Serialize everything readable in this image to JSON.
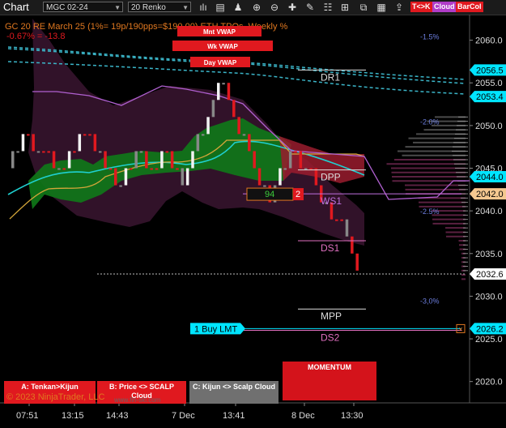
{
  "toolbar": {
    "title": "Chart",
    "instrument": "MGC 02-24",
    "bar_type": "20 Renko",
    "buttons": [
      {
        "label": "T<>K",
        "color": "#e0191f"
      },
      {
        "label": "Cloud",
        "color": "#b03cc8"
      },
      {
        "label": "BarCol",
        "color": "#e0191f"
      }
    ]
  },
  "header": {
    "line1": "GC 20 RE March 25 (1%= 19p/190pps=$190.00)  ETH TPOs, Weekly %",
    "line2": "-0.67% = -13.8",
    "copyright": "© 2023 NinjaTrader, LLC",
    "watermark": "www.fin-ski.com"
  },
  "vwap_labels": [
    "Mnt VWAP",
    "Wk VWAP",
    "Day VWAP"
  ],
  "levels": [
    {
      "name": "DR1",
      "price": 2056.5,
      "color": "#dddddd"
    },
    {
      "name": "DPP",
      "price": 2044.8,
      "color": "#dddddd"
    },
    {
      "name": "WS1",
      "price": 2042.0,
      "color": "#c070e0"
    },
    {
      "name": "DS1",
      "price": 2036.5,
      "color": "#e070c0"
    },
    {
      "name": "MPP",
      "price": 2028.5,
      "color": "#dddddd"
    },
    {
      "name": "DS2",
      "price": 2026.0,
      "color": "#e070c0"
    }
  ],
  "percent_labels": [
    {
      "label": "-1.5%",
      "price": 2060.5
    },
    {
      "label": "-2.0%",
      "price": 2050.5
    },
    {
      "label": "-2.5%",
      "price": 2040.0
    },
    {
      "label": "-3,0%",
      "price": 2029.5
    }
  ],
  "price_flags": [
    {
      "text": "2056.5",
      "price": 2056.5,
      "bg": "#00e5ff",
      "fg": "#000000"
    },
    {
      "text": "2053.4",
      "price": 2053.4,
      "bg": "#00e5ff",
      "fg": "#000000"
    },
    {
      "text": "2044.0",
      "price": 2044.0,
      "bg": "#00e5ff",
      "fg": "#000000"
    },
    {
      "text": "2042.0",
      "price": 2042.0,
      "bg": "#f5c890",
      "fg": "#000000"
    },
    {
      "text": "2032.6",
      "price": 2032.6,
      "bg": "#ffffff",
      "fg": "#000000"
    },
    {
      "text": "2026.2",
      "price": 2026.2,
      "bg": "#00e5ff",
      "fg": "#000000"
    }
  ],
  "order": {
    "label": "1 Buy LMT",
    "price": 2026.2
  },
  "position_box": {
    "left": "94",
    "right": "2"
  },
  "panels": [
    {
      "label": "A: Tenkan>Kijun",
      "bg": "#e0191f"
    },
    {
      "label": "B: Price <> SCALP Cloud",
      "bg": "#e0191f"
    },
    {
      "label": "C: Kijun <> Scalp Cloud",
      "bg": "#707070"
    }
  ],
  "momentum_label": "MOMENTUM",
  "chart_data": {
    "type": "bar",
    "title": "GC 20 RE March 25 (1%= 19p/190pps=$190.00)  ETH TPOs, Weekly %",
    "xlabel": "",
    "ylabel": "",
    "ylim": [
      2017.5,
      2063
    ],
    "y_ticks": [
      2020.0,
      2025.0,
      2030.0,
      2035.0,
      2040.0,
      2045.0,
      2050.0,
      2055.0,
      2060.0
    ],
    "x_ticks": [
      "07:51",
      "13:15",
      "14:43",
      "7 Dec",
      "13:41",
      "8 Dec",
      "13:30"
    ],
    "grid": false,
    "series": [
      {
        "name": "renko",
        "values": [
          2047,
          2047,
          2049,
          2049,
          2047,
          2047,
          2047,
          2047,
          2045,
          2045,
          2045,
          2047,
          2047,
          2049,
          2049,
          2049,
          2047,
          2047,
          2045,
          2045,
          2043,
          2043,
          2045,
          2045,
          2047,
          2047,
          2045,
          2045,
          2045,
          2047,
          2047,
          2045,
          2045,
          2043,
          2045,
          2047,
          2049,
          2049,
          2051,
          2053,
          2055,
          2055,
          2053,
          2051,
          2049,
          2049,
          2047,
          2045,
          2043,
          2043,
          2041,
          2043,
          2045,
          2045,
          2047,
          2047,
          2045,
          2045,
          2045,
          2043,
          2041,
          2041,
          2039,
          2039,
          2039,
          2037,
          2035,
          2033
        ]
      }
    ]
  }
}
